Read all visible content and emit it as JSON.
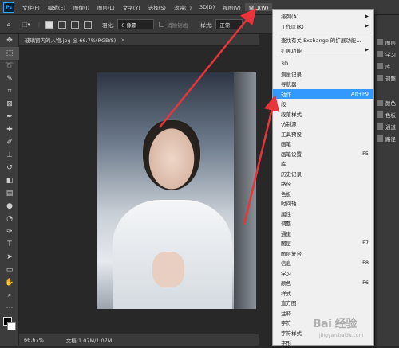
{
  "app": {
    "logo": "Ps"
  },
  "menubar": {
    "items": [
      "文件(F)",
      "编辑(E)",
      "图像(I)",
      "图层(L)",
      "文字(Y)",
      "选择(S)",
      "滤镜(T)",
      "3D(D)",
      "视图(V)",
      "窗口(W)"
    ],
    "active_index": 9
  },
  "options": {
    "feather_label": "羽化:",
    "feather_value": "0 像素",
    "antialias_label": "消除锯齿",
    "style_label": "样式:",
    "style_value": "正常"
  },
  "document": {
    "tab_title": "玻璃窗内的人物.jpg @ 66.7%(RGB/8)",
    "close_glyph": "×",
    "zoom": "66.67%",
    "doc_info": "文档:1.07M/1.07M"
  },
  "window_menu": {
    "items": [
      {
        "label": "排列(A)",
        "submenu": true
      },
      {
        "label": "工作区(K)",
        "submenu": true
      },
      {
        "sep": true
      },
      {
        "label": "查找有关 Exchange 的扩展功能..."
      },
      {
        "label": "扩展功能",
        "submenu": true
      },
      {
        "sep": true
      },
      {
        "label": "3D"
      },
      {
        "label": "测量记录"
      },
      {
        "label": "导航器"
      },
      {
        "label": "动作",
        "shortcut": "Alt+F9",
        "highlighted": true
      },
      {
        "label": "段"
      },
      {
        "label": "段落样式"
      },
      {
        "label": "仿制源"
      },
      {
        "label": "工具预设"
      },
      {
        "label": "画笔"
      },
      {
        "label": "画笔设置",
        "shortcut": "F5"
      },
      {
        "label": "库"
      },
      {
        "label": "历史记录"
      },
      {
        "label": "路径"
      },
      {
        "label": "色板"
      },
      {
        "label": "时间轴"
      },
      {
        "label": "属性"
      },
      {
        "label": "调整"
      },
      {
        "label": "通道"
      },
      {
        "label": "图层",
        "shortcut": "F7"
      },
      {
        "label": "图层复合"
      },
      {
        "label": "信息",
        "shortcut": "F8"
      },
      {
        "label": "学习"
      },
      {
        "label": "颜色",
        "shortcut": "F6"
      },
      {
        "label": "样式"
      },
      {
        "label": "直方图"
      },
      {
        "label": "注释"
      },
      {
        "label": "字符"
      },
      {
        "label": "字符样式"
      },
      {
        "label": "字形"
      }
    ]
  },
  "right_panel": {
    "items": [
      "图层",
      "学习",
      "库",
      "调整",
      "颜色",
      "色板",
      "通道",
      "路径"
    ]
  },
  "tools": [
    "move-icon",
    "marquee-icon",
    "lasso-icon",
    "quick-select-icon",
    "crop-icon",
    "frame-icon",
    "eyedropper-icon",
    "healing-icon",
    "brush-icon",
    "stamp-icon",
    "history-brush-icon",
    "eraser-icon",
    "gradient-icon",
    "blur-icon",
    "dodge-icon",
    "pen-icon",
    "type-icon",
    "path-select-icon",
    "shape-icon",
    "hand-icon",
    "zoom-icon"
  ],
  "watermark": {
    "text": "Bai 经验",
    "subtext": "jingyan.baidu.com"
  },
  "colors": {
    "highlight": "#3399ff",
    "arrow": "#e8343a",
    "menu_bg": "#f0f0f0"
  }
}
